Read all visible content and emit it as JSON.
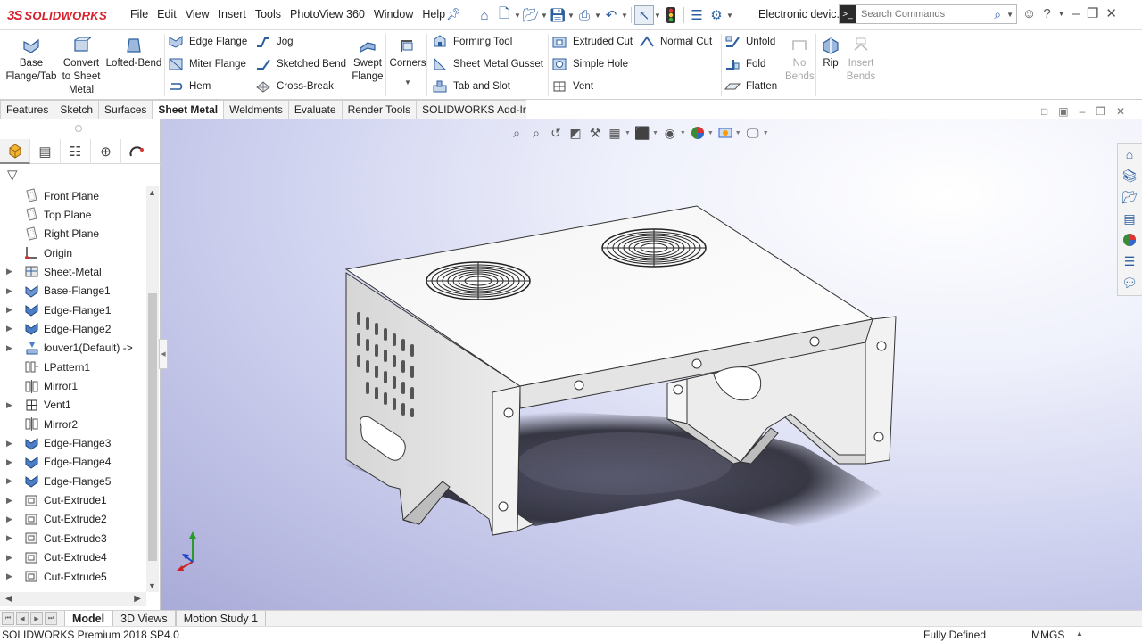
{
  "app": {
    "logo_ds": "3S",
    "logo_brand": "SOLIDWORKS",
    "document_title": "Electronic devic...",
    "status_version": "SOLIDWORKS Premium 2018 SP4.0",
    "status_defined": "Fully Defined",
    "status_units": "MMGS"
  },
  "menu": [
    "File",
    "Edit",
    "View",
    "Insert",
    "Tools",
    "PhotoView 360",
    "Window",
    "Help"
  ],
  "search": {
    "placeholder": "Search Commands"
  },
  "command_manager": {
    "base_flange": "Base\nFlange/Tab",
    "convert": "Convert\nto Sheet\nMetal",
    "lofted_bend": "Lofted-Bend",
    "edge_flange": "Edge Flange",
    "miter_flange": "Miter Flange",
    "hem": "Hem",
    "jog": "Jog",
    "sketched_bend": "Sketched Bend",
    "cross_break": "Cross-Break",
    "swept_flange": "Swept\nFlange",
    "corners": "Corners",
    "forming_tool": "Forming Tool",
    "sheet_metal_gusset": "Sheet Metal Gusset",
    "tab_and_slot": "Tab and Slot",
    "extruded_cut": "Extruded Cut",
    "simple_hole": "Simple Hole",
    "vent": "Vent",
    "normal_cut": "Normal Cut",
    "unfold": "Unfold",
    "fold": "Fold",
    "flatten": "Flatten",
    "no_bends": "No\nBends",
    "rip": "Rip",
    "insert_bends": "Insert\nBends"
  },
  "tabs": [
    {
      "label": "Features",
      "active": false
    },
    {
      "label": "Sketch",
      "active": false
    },
    {
      "label": "Surfaces",
      "active": false
    },
    {
      "label": "Sheet Metal",
      "active": true
    },
    {
      "label": "Weldments",
      "active": false
    },
    {
      "label": "Evaluate",
      "active": false
    },
    {
      "label": "Render Tools",
      "active": false
    },
    {
      "label": "SOLIDWORKS Add-Ins",
      "active": false
    }
  ],
  "tree": [
    {
      "label": "Front Plane",
      "expandable": false,
      "icon": "plane-icon"
    },
    {
      "label": "Top Plane",
      "expandable": false,
      "icon": "plane-icon"
    },
    {
      "label": "Right Plane",
      "expandable": false,
      "icon": "plane-icon"
    },
    {
      "label": "Origin",
      "expandable": false,
      "icon": "origin-icon"
    },
    {
      "label": "Sheet-Metal",
      "expandable": true,
      "icon": "sheet-metal-icon"
    },
    {
      "label": "Base-Flange1",
      "expandable": true,
      "icon": "base-flange-icon"
    },
    {
      "label": "Edge-Flange1",
      "expandable": true,
      "icon": "edge-flange-icon"
    },
    {
      "label": "Edge-Flange2",
      "expandable": true,
      "icon": "edge-flange-icon"
    },
    {
      "label": "louver1(Default) ->",
      "expandable": true,
      "icon": "louver-icon"
    },
    {
      "label": "LPattern1",
      "expandable": false,
      "icon": "pattern-icon"
    },
    {
      "label": "Mirror1",
      "expandable": false,
      "icon": "mirror-icon"
    },
    {
      "label": "Vent1",
      "expandable": true,
      "icon": "vent-icon"
    },
    {
      "label": "Mirror2",
      "expandable": false,
      "icon": "mirror-icon"
    },
    {
      "label": "Edge-Flange3",
      "expandable": true,
      "icon": "edge-flange-icon"
    },
    {
      "label": "Edge-Flange4",
      "expandable": true,
      "icon": "edge-flange-icon"
    },
    {
      "label": "Edge-Flange5",
      "expandable": true,
      "icon": "edge-flange-icon"
    },
    {
      "label": "Cut-Extrude1",
      "expandable": true,
      "icon": "cut-extrude-icon"
    },
    {
      "label": "Cut-Extrude2",
      "expandable": true,
      "icon": "cut-extrude-icon"
    },
    {
      "label": "Cut-Extrude3",
      "expandable": true,
      "icon": "cut-extrude-icon"
    },
    {
      "label": "Cut-Extrude4",
      "expandable": true,
      "icon": "cut-extrude-icon"
    },
    {
      "label": "Cut-Extrude5",
      "expandable": true,
      "icon": "cut-extrude-icon"
    }
  ],
  "bottom_tabs": [
    {
      "label": "Model",
      "active": true
    },
    {
      "label": "3D Views",
      "active": false
    },
    {
      "label": "Motion Study 1",
      "active": false
    }
  ],
  "colors": {
    "accent": "#2c5fa0",
    "brand": "#d6212a"
  }
}
